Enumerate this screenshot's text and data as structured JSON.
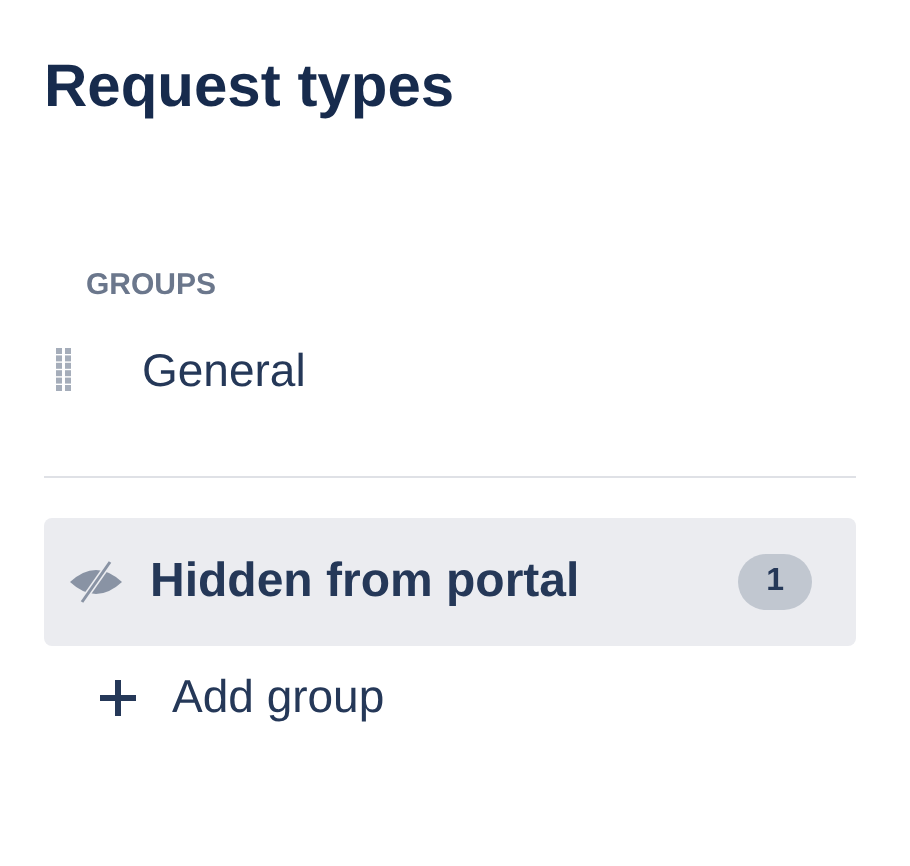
{
  "title": "Request types",
  "groups_heading": "GROUPS",
  "groups": [
    {
      "label": "General",
      "selected": false
    }
  ],
  "hidden_group": {
    "label": "Hidden from portal",
    "count": "1",
    "selected": true
  },
  "add_group": {
    "label": "Add group"
  }
}
